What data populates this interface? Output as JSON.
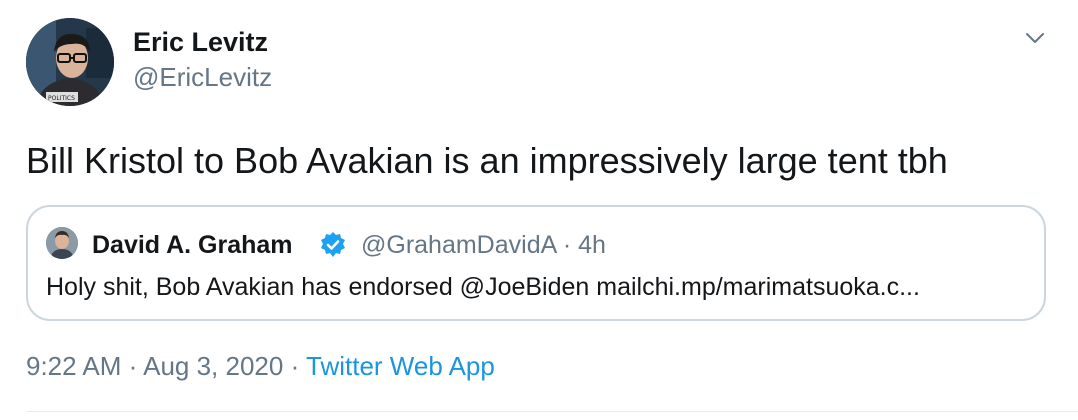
{
  "tweet": {
    "author": {
      "name": "Eric Levitz",
      "handle": "@EricLevitz",
      "avatar_badge": "POLITICS"
    },
    "menu_icon": "chevron-down-icon",
    "text": "Bill Kristol to Bob Avakian is an impressively large tent tbh",
    "quoted": {
      "name": "David A. Graham",
      "verified_icon": "verified-badge-icon",
      "handle": "@GrahamDavidA",
      "separator": "·",
      "age": "4h",
      "text": "Holy shit, Bob Avakian has endorsed @JoeBiden mailchi.mp/marimatsuoka.c..."
    },
    "time": "9:22 AM",
    "date": "Aug 3, 2020",
    "dot": "·",
    "source": "Twitter Web App"
  },
  "colors": {
    "text": "#14171a",
    "secondary": "#657786",
    "link": "#1b95e0",
    "verified": "#1da1f2",
    "border": "#ccd6dd"
  }
}
